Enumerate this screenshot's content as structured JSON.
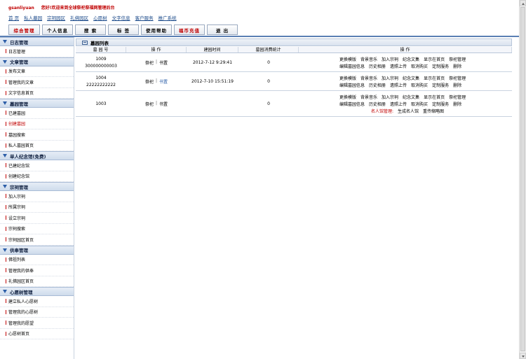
{
  "header": {
    "username": "gsanliyuan",
    "welcome": "您好!欢迎来到全球祭祀祭福网管理后台"
  },
  "topnav": [
    "首 页",
    "私人墓园",
    "宗祠园区",
    "礼佛园区",
    "心愿树",
    "文字信息",
    "客户服务",
    "推广系统"
  ],
  "tabs": [
    {
      "label": "综合管理",
      "active": true
    },
    {
      "label": "个人信息"
    },
    {
      "label": "搜 索"
    },
    {
      "label": "标 签"
    },
    {
      "label": "使用帮助"
    },
    {
      "label": "福币充值"
    },
    {
      "label": "退 出"
    }
  ],
  "sidebar": [
    {
      "title": "日志管理",
      "items": [
        "日志管理"
      ]
    },
    {
      "title": "文章管理",
      "items": [
        "发布文章",
        "管理我的文章",
        "文字信息首页"
      ]
    },
    {
      "title": "墓园管理",
      "items": [
        "已建墓园",
        "创建墓园",
        "墓园搜索",
        "私人墓园首页"
      ]
    },
    {
      "title": "单人纪念馆(免费)",
      "items": [
        "已建纪念馆",
        "创建纪念馆"
      ]
    },
    {
      "title": "宗祠管理",
      "items": [
        "加入宗祠",
        "所属宗祠",
        "设立宗祠",
        "宗祠搜索",
        "宗祠园区首页"
      ]
    },
    {
      "title": "供奉管理",
      "items": [
        "佛祖列表",
        "管理我的供奉",
        "礼佛园区首页"
      ]
    },
    {
      "title": "心愿树管理",
      "items": [
        "建立私人心愿树",
        "管理我的心愿树",
        "管理我的愿望",
        "心愿树首页"
      ]
    }
  ],
  "panel": {
    "title": "墓园列表",
    "headers": [
      "墓 园 号",
      "操    作",
      "建园时间",
      "墓园消费统计",
      "操    作"
    ]
  },
  "rows": [
    {
      "id": "1009",
      "sub": "300000000003",
      "action1": "祭祀",
      "action2": "书置",
      "date": "2012-7-12 9:29:41",
      "spend": "0",
      "ops": [
        [
          "更换模版",
          "背景音乐",
          "加入宗祠",
          "纪念文集",
          "显示在首页",
          "祭祀管理"
        ],
        [
          "编辑墓园信息",
          "历史相册",
          "遗照上传",
          "取消购买",
          "定制服务",
          "删除"
        ]
      ]
    },
    {
      "id": "1004",
      "sub": "22222222222",
      "action1": "祭祀",
      "action2": "书置",
      "date": "2012-7-10 15:51:19",
      "spend": "0",
      "ops": [
        [
          "更换模版",
          "背景音乐",
          "加入宗祠",
          "纪念文集",
          "显示在首页",
          "祭祀管理"
        ],
        [
          "编辑墓园信息",
          "历史相册",
          "遗照上传",
          "取消购买",
          "定制服务",
          "删除"
        ]
      ]
    },
    {
      "id": "1003",
      "sub": "",
      "action1": "祭祀",
      "action2": "书置",
      "date": "",
      "spend": "0",
      "ops": [
        [
          "更换模版",
          "背景音乐",
          "加入宗祠",
          "纪念文集",
          "显示在首页",
          "祭祀管理"
        ],
        [
          "编辑墓园信息",
          "历史相册",
          "遗照上传",
          "取消购买",
          "定制服务",
          "删除"
        ]
      ],
      "extra": {
        "label": "名人馆管理:",
        "items": [
          "生成名人馆",
          "重传缩略图"
        ]
      }
    }
  ]
}
